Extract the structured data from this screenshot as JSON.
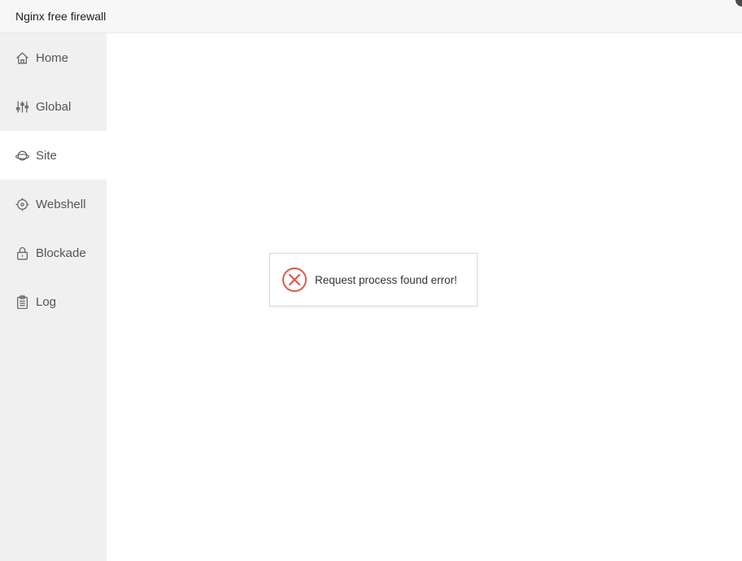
{
  "header": {
    "title": "Nginx free firewall"
  },
  "sidebar": {
    "items": [
      {
        "label": "Home",
        "icon": "home-icon",
        "active": false
      },
      {
        "label": "Global",
        "icon": "sliders-icon",
        "active": false
      },
      {
        "label": "Site",
        "icon": "planet-icon",
        "active": true
      },
      {
        "label": "Webshell",
        "icon": "target-icon",
        "active": false
      },
      {
        "label": "Blockade",
        "icon": "lock-icon",
        "active": false
      },
      {
        "label": "Log",
        "icon": "clipboard-icon",
        "active": false
      }
    ]
  },
  "toast": {
    "message": "Request process found error!",
    "icon": "error-circle-icon",
    "color": "#e0584a"
  },
  "colors": {
    "sidebar_bg": "#f0f0f0",
    "header_bg": "#f7f7f7",
    "active_item_bg": "#ffffff"
  }
}
